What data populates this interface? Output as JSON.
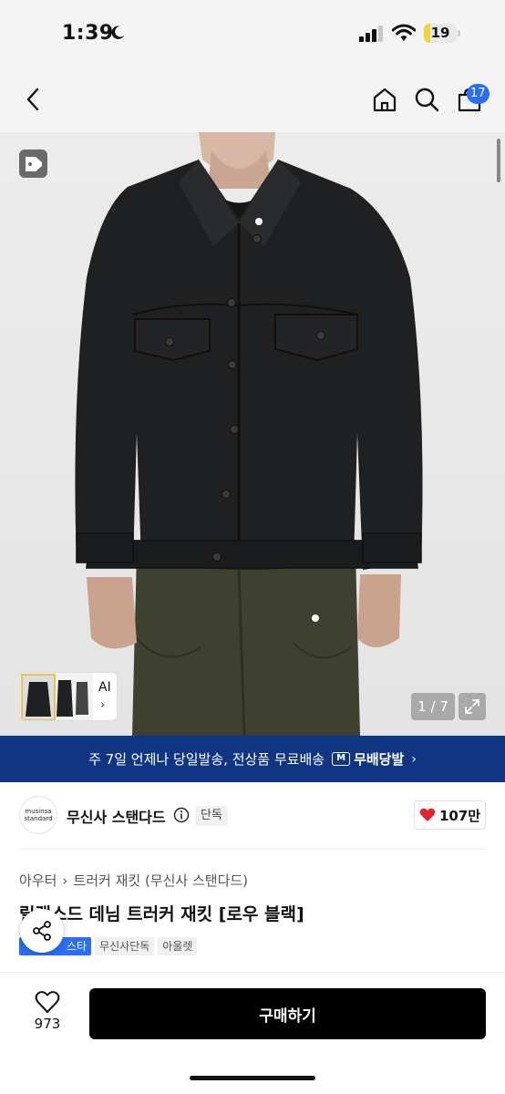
{
  "status_bar": {
    "time": "1:39",
    "battery": "19",
    "battery_level_percent": 19
  },
  "header": {
    "cart_count": "17"
  },
  "gallery": {
    "counter": "1 / 7",
    "thumb_label": "AI",
    "thumb_chevron": "›"
  },
  "banner": {
    "message": "주 7일 언제나 당일발송, 전상품 무료배송",
    "logo_mark": "M",
    "logo_text": "무배당발",
    "chevron": "›"
  },
  "brand": {
    "logo_line1": "musinsa",
    "logo_line2": "standard",
    "name": "무신사 스탠다드",
    "exclusive_label": "단독",
    "like_count": "107만"
  },
  "product": {
    "breadcrumb": [
      "아우터",
      "트러커 재킷 (무신사 스탠다드)"
    ],
    "breadcrumb_sep": "›",
    "title": "릴랙스드 데님 트러커 재킷 [로우 블랙]",
    "chips": [
      "스타",
      "무신사단독",
      "아울렛"
    ]
  },
  "bottom_bar": {
    "wish_count": "973",
    "buy_label": "구매하기"
  },
  "colors": {
    "accent_blue": "#2a6ef5",
    "banner_navy": "#103683",
    "heart_red": "#e5222f"
  },
  "icons": [
    "moon-icon",
    "signal-icon",
    "wifi-icon",
    "back-icon",
    "home-icon",
    "search-icon",
    "cart-icon",
    "tag-icon",
    "expand-icon",
    "info-icon",
    "heart-icon",
    "share-icon"
  ]
}
